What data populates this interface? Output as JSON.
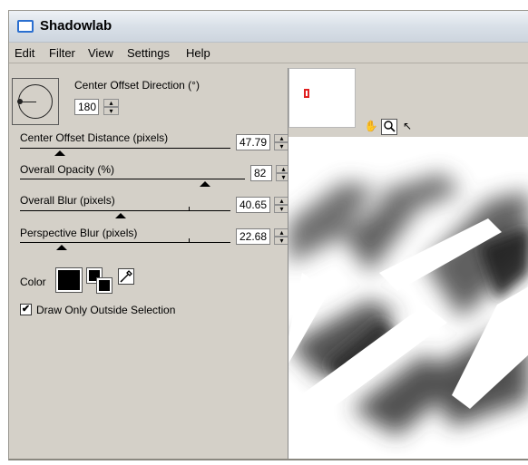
{
  "window": {
    "title": "Shadowlab"
  },
  "menu": [
    "Edit",
    "Filter",
    "View",
    "Settings",
    "Help"
  ],
  "direction": {
    "label": "Center Offset Direction (°)",
    "value": "180"
  },
  "sliders": [
    {
      "label": "Center Offset Distance (pixels)",
      "value": "47.79",
      "level_percent": 19
    },
    {
      "label": "Overall Opacity (%)",
      "value": "82",
      "level_percent": 82
    },
    {
      "label": "Overall Blur (pixels)",
      "value": "40.65",
      "level_percent": 45
    },
    {
      "label": "Perspective Blur (pixels)",
      "value": "22.68",
      "level_percent": 19
    }
  ],
  "color": {
    "label": "Color",
    "value": "#000000"
  },
  "checkbox": {
    "label": "Draw Only Outside Selection",
    "checked": true,
    "mark": "✔"
  },
  "tools": [
    {
      "name": "hand-tool",
      "glyph": "✋"
    },
    {
      "name": "zoom-tool",
      "glyph": "🔍"
    },
    {
      "name": "pointer-tool",
      "glyph": "↖"
    }
  ]
}
